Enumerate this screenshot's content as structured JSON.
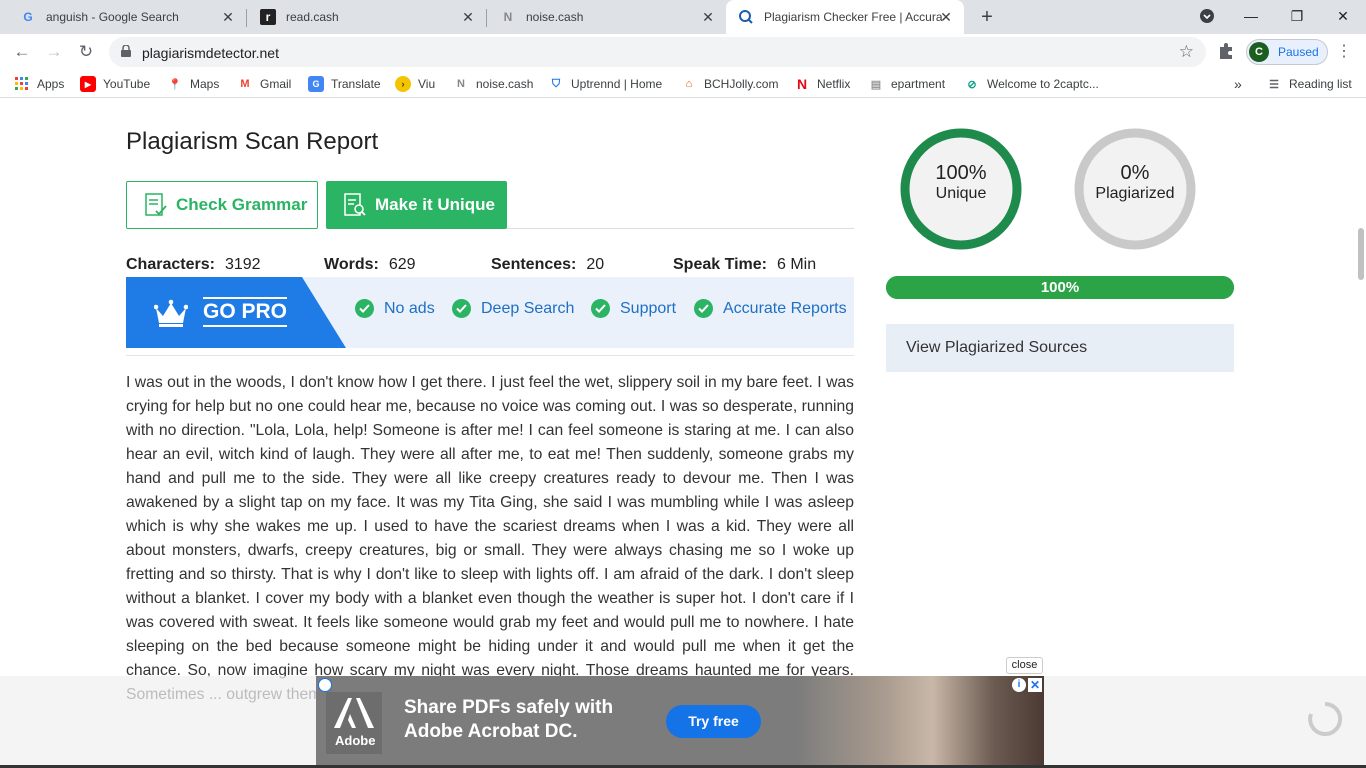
{
  "browser": {
    "tabs": [
      {
        "title": "anguish - Google Search",
        "favicon": "G"
      },
      {
        "title": "read.cash",
        "favicon": "r"
      },
      {
        "title": "noise.cash",
        "favicon": "N"
      },
      {
        "title": "Plagiarism Checker Free | Accurat",
        "favicon": "search-icon"
      }
    ],
    "url": "plagiarismdetector.net",
    "profile_initial": "C",
    "profile_status": "Paused",
    "bookmarks": [
      "Apps",
      "YouTube",
      "Maps",
      "Gmail",
      "Translate",
      "Viu",
      "noise.cash",
      "Uptrennd | Home",
      "BCHJolly.com",
      "Netflix",
      "epartment",
      "Welcome to 2captc..."
    ],
    "bookmarks_more": "»",
    "reading_list": "Reading list"
  },
  "report": {
    "title": "Plagiarism Scan Report",
    "check_grammar": "Check Grammar",
    "make_unique": "Make it Unique",
    "stats": {
      "characters_label": "Characters:",
      "characters": "3192",
      "words_label": "Words:",
      "words": "629",
      "sentences_label": "Sentences:",
      "sentences": "20",
      "speak_label": "Speak Time:",
      "speak": "6 Min"
    },
    "gopro": {
      "label": "GO PRO",
      "features": [
        "No ads",
        "Deep Search",
        "Support",
        "Accurate Reports"
      ]
    },
    "body": "I was out in the woods, I don't know how I get there. I just feel the wet, slippery soil in my bare feet. I was crying for help but no one could hear me, because no voice was coming out. I was so desperate, running with no direction. \"Lola, Lola, help! Someone is after me! I can feel someone is staring at me. I can also hear an evil, witch kind of laugh. They were all after me, to eat me! Then suddenly, someone grabs my hand and pull me to the side. They were all like creepy creatures ready to devour me. Then I was awakened by a slight tap on my face. It was my Tita Ging, she said I was mumbling while I was asleep which is why she wakes me up. I used to have the scariest dreams when I was a kid. They were all about monsters, dwarfs, creepy creatures, big or small. They were always chasing me so I woke up fretting and so thirsty. That is why I don't like to sleep with lights off. I am afraid of the dark. I don't sleep without a blanket. I cover my body with a blanket even though the weather is super hot. I don't care if I was covered with sweat. It feels like someone would grab my feet and would pull me to nowhere. I hate sleeping on the bed because someone might be hiding under it and would pull me when it get the chance. So, now imagine how scary my night was every night. Those dreams haunted me for years. Sometimes ... outgrew them. I no longer ... blanket unless it is freezing ..."
  },
  "results": {
    "unique_pct": "100%",
    "unique_label": "Unique",
    "unique_value": 1.0,
    "plag_pct": "0%",
    "plag_label": "Plagiarized",
    "plag_value": 0.0,
    "bar_label": "100%",
    "bar_value": 1.0,
    "view_sources": "View Plagiarized Sources"
  },
  "ad": {
    "brand": "Adobe",
    "headline": "Share PDFs safely with Adobe Acrobat DC.",
    "cta": "Try free",
    "close_label": "close"
  },
  "colors": {
    "accent_green": "#2ab463",
    "ring_green": "#1e8a4c",
    "ring_gray": "#c9c9c9",
    "gopro_blue": "#1f7ce6"
  }
}
